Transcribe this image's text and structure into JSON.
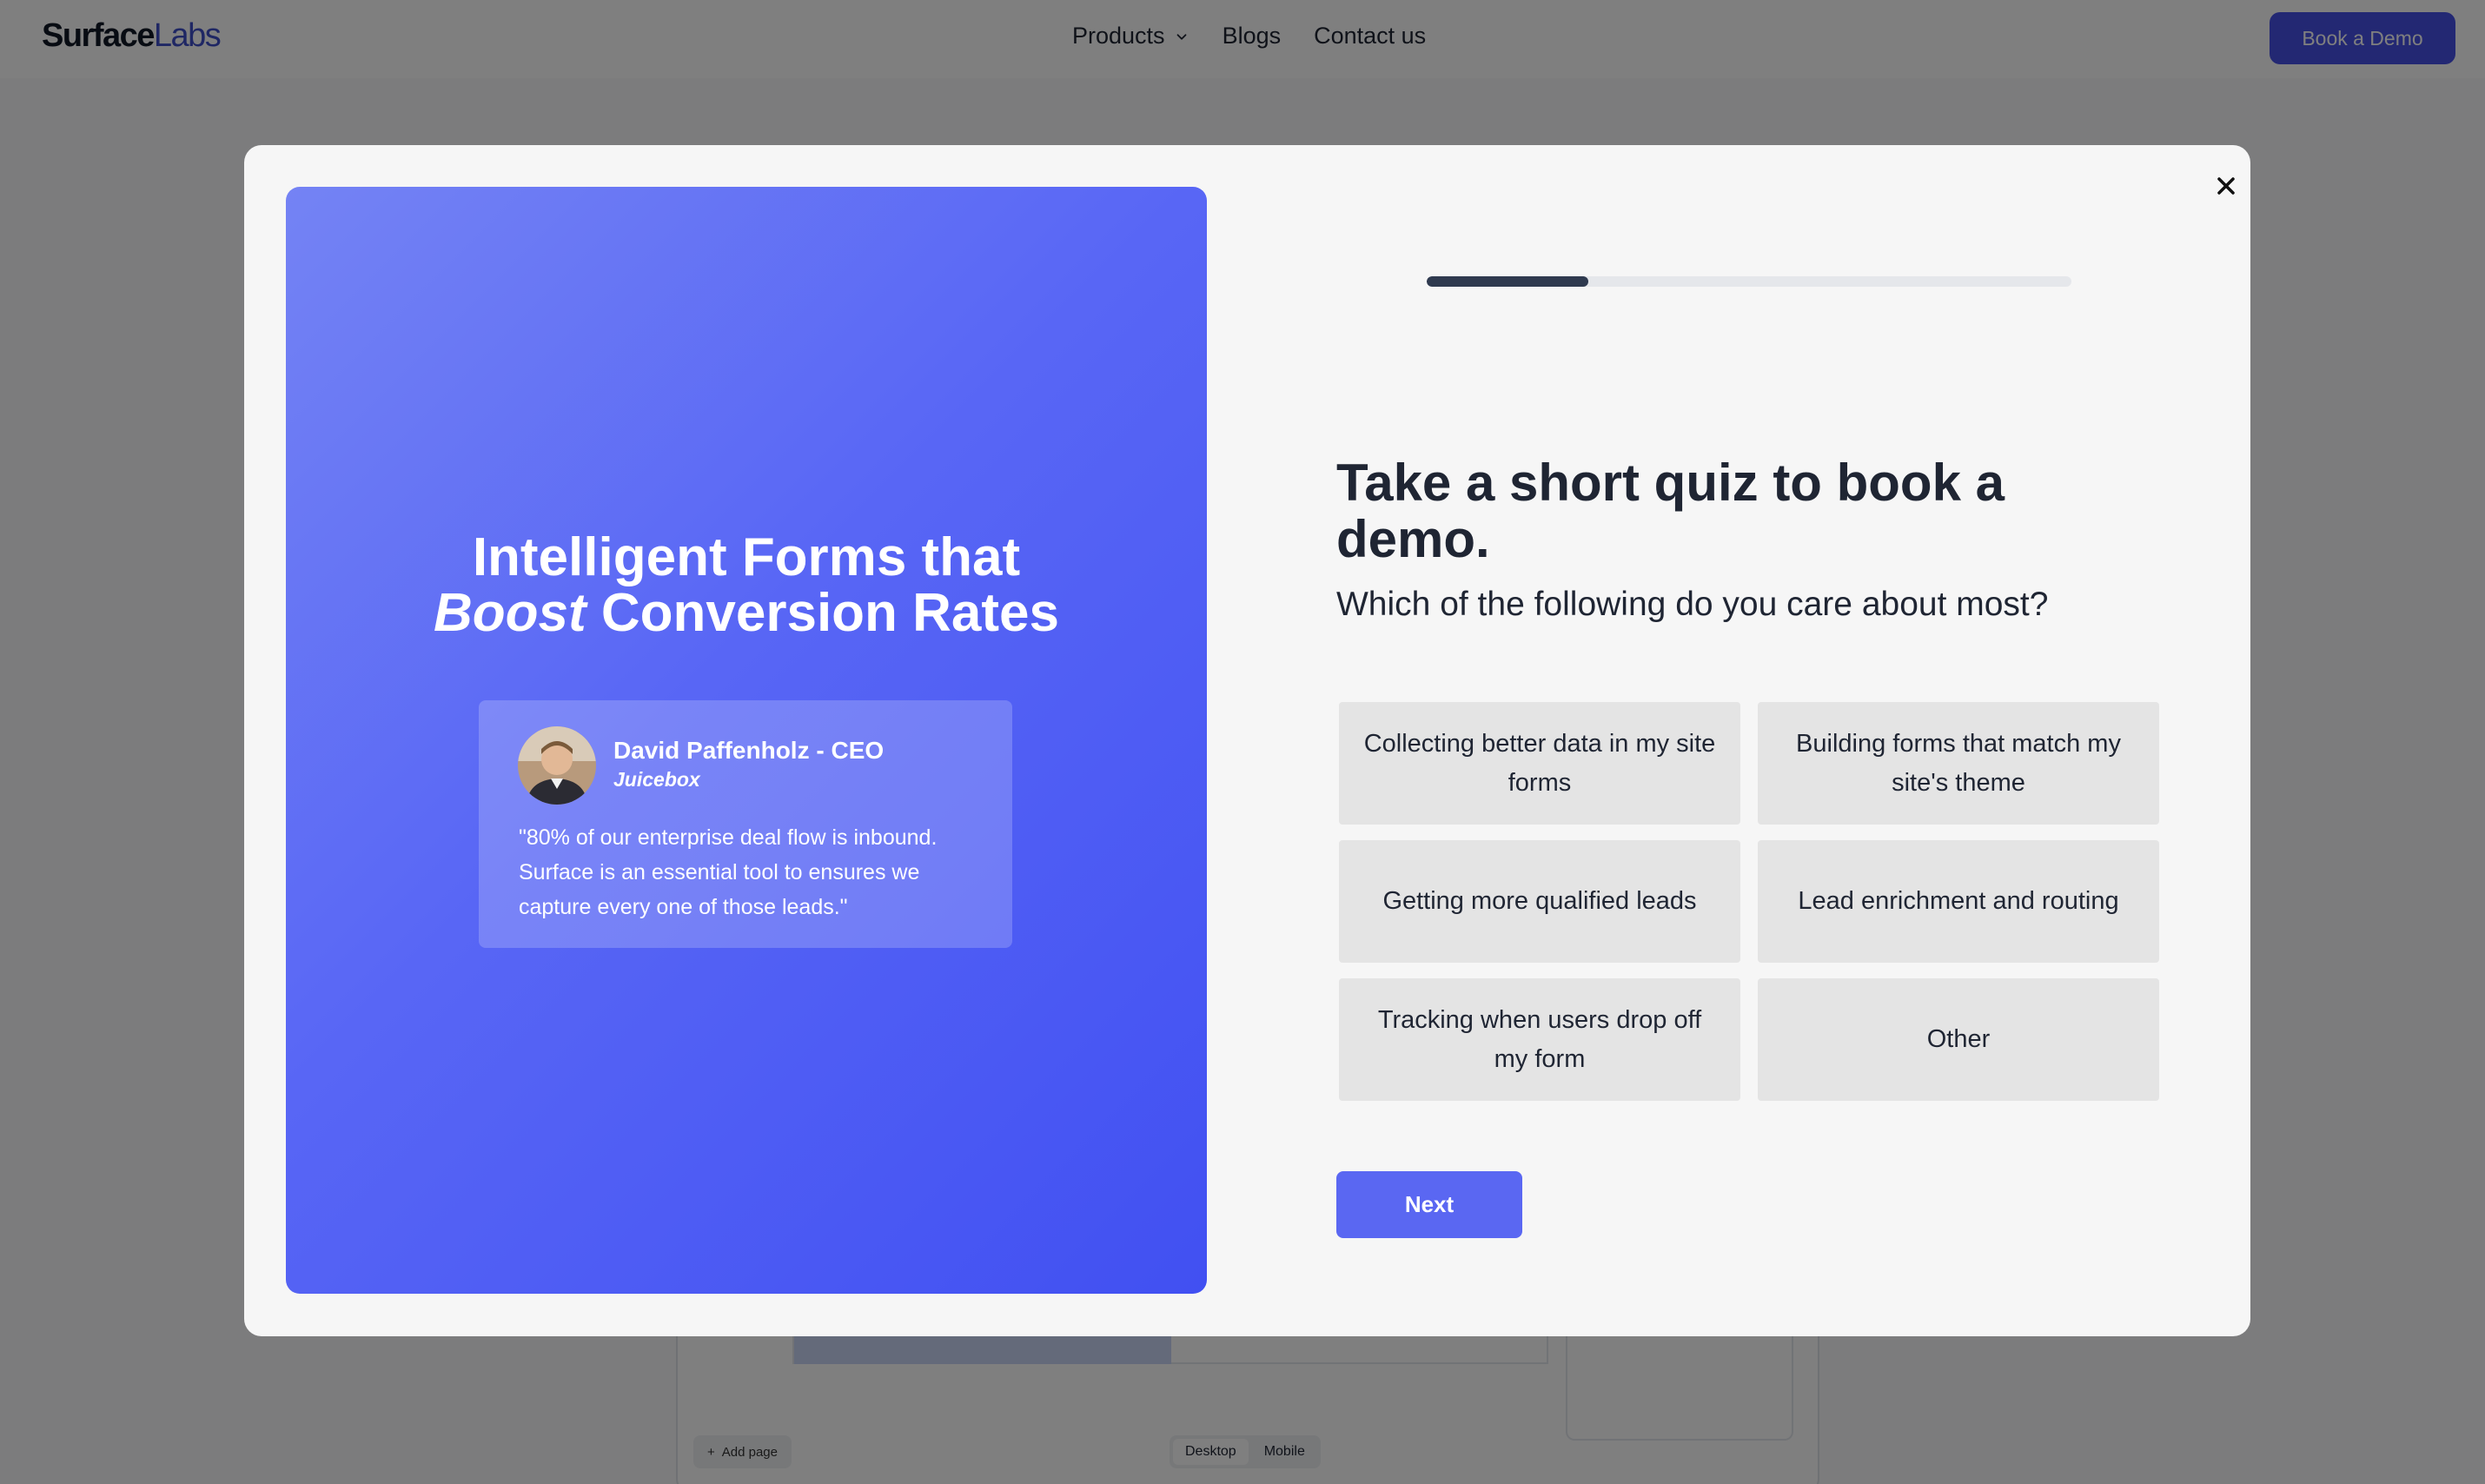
{
  "nav": {
    "logo_surface": "Surface",
    "logo_labs": "Labs",
    "links": [
      "Products",
      "Blogs",
      "Contact us"
    ],
    "cta": "Book a Demo"
  },
  "builder": {
    "add_page": "Add page",
    "view_desktop": "Desktop",
    "view_mobile": "Mobile"
  },
  "modal": {
    "hero": {
      "title_line1": "Intelligent Forms that",
      "title_em": "Boost",
      "title_line2_rest": " Conversion Rates"
    },
    "testimonial": {
      "name": "David Paffenholz - CEO",
      "company": "Juicebox",
      "quote": "\"80% of our enterprise deal flow is inbound. Surface is an essential tool to ensures we capture every one of those leads.\""
    },
    "progress": 0.25,
    "heading": "Take a short quiz to book a demo.",
    "question": "Which of the following do you care about most?",
    "options": [
      "Collecting better data in my site forms",
      "Building forms that match my site's theme",
      "Getting more qualified leads",
      "Lead enrichment and routing",
      "Tracking when users drop off my form",
      "Other"
    ],
    "next_label": "Next"
  },
  "colors": {
    "accent": "#5a67f2",
    "brand_labs": "#3f4fc9",
    "progress": "#2f3a4f"
  }
}
